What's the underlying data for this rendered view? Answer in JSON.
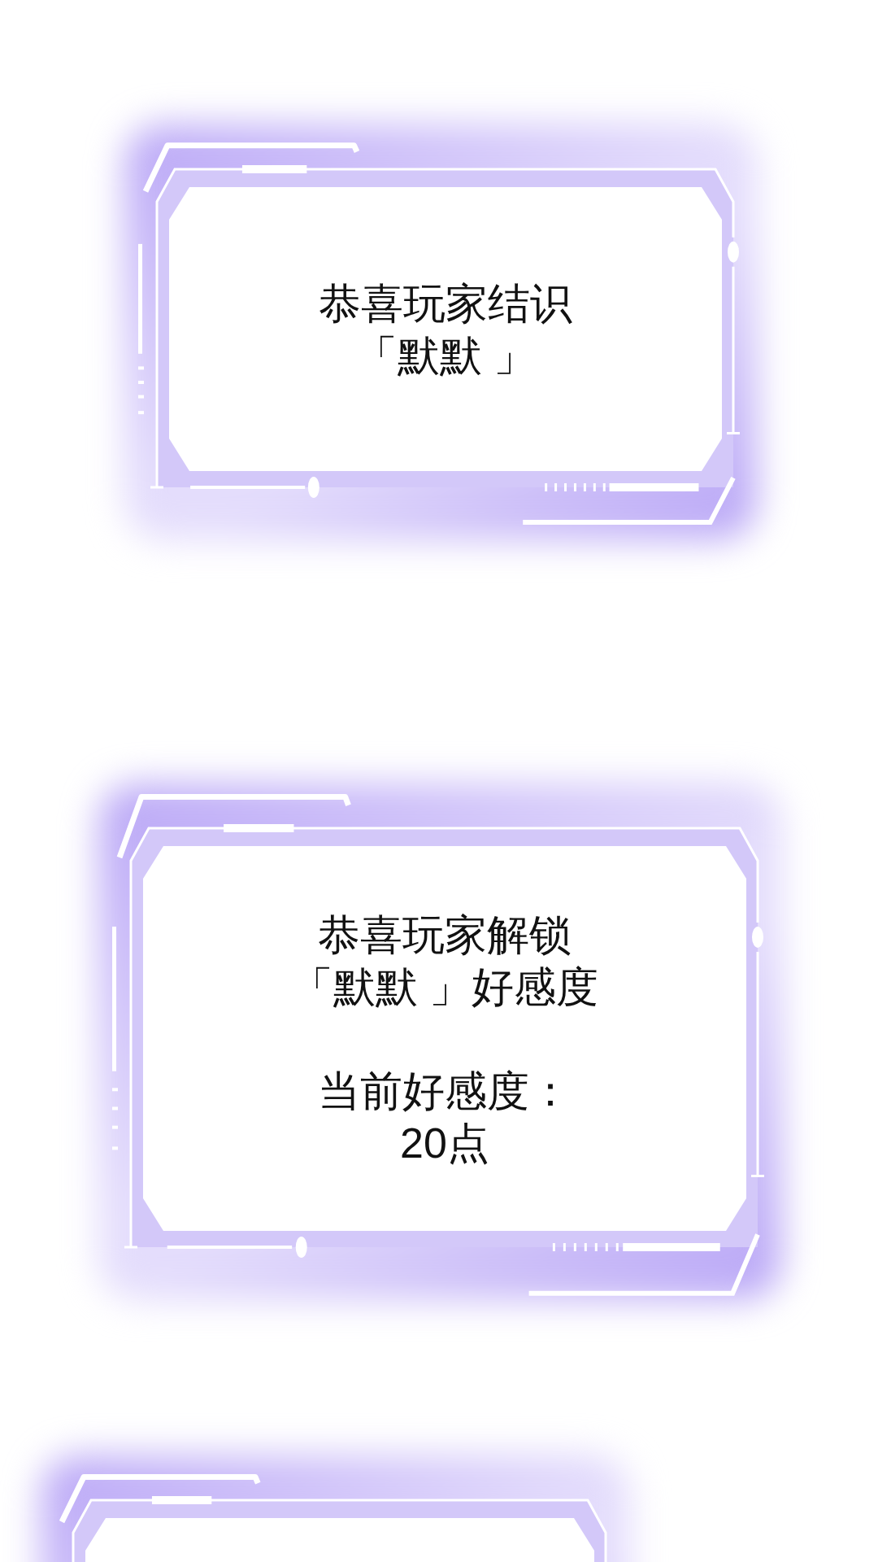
{
  "panels": [
    {
      "kind": "system-window",
      "messages": [
        {
          "lines": [
            "恭喜玩家结识",
            "「默默 」"
          ]
        }
      ]
    },
    {
      "kind": "system-window",
      "messages": [
        {
          "lines": [
            "恭喜玩家解锁",
            "「默默 」好感度"
          ]
        },
        {
          "lines": [
            "当前好感度：",
            "20点"
          ]
        }
      ]
    },
    {
      "kind": "system-window"
    }
  ]
}
